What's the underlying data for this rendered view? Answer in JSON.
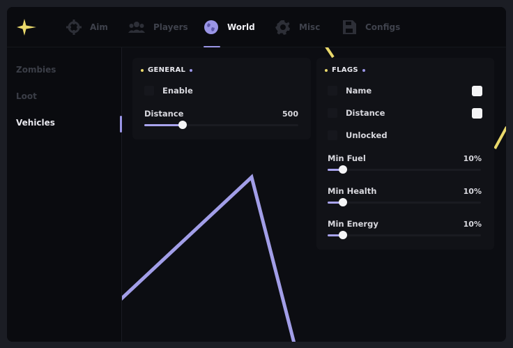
{
  "colors": {
    "accent": "#9a95e6",
    "highlight": "#e9d86b",
    "background": "#0c0d12"
  },
  "tabs": [
    {
      "label": "Aim",
      "icon": "crosshair-icon",
      "active": false
    },
    {
      "label": "Players",
      "icon": "users-icon",
      "active": false
    },
    {
      "label": "World",
      "icon": "globe-icon",
      "active": true
    },
    {
      "label": "Misc",
      "icon": "gear-icon",
      "active": false
    },
    {
      "label": "Configs",
      "icon": "save-icon",
      "active": false
    }
  ],
  "sidebar": {
    "items": [
      {
        "label": "Zombies",
        "active": false
      },
      {
        "label": "Loot",
        "active": false
      },
      {
        "label": "Vehicles",
        "active": true
      }
    ]
  },
  "general": {
    "title": "GENERAL",
    "enable_label": "Enable",
    "enable_checked": false,
    "distance_label": "Distance",
    "distance_value": "500",
    "distance_fraction": 0.25
  },
  "flags": {
    "title": "FLAGS",
    "name_label": "Name",
    "name_checked": false,
    "name_color": "#f4f4f6",
    "distance_label": "Distance",
    "distance_checked": false,
    "distance_color": "#f4f4f6",
    "unlocked_label": "Unlocked",
    "unlocked_checked": false,
    "min_fuel_label": "Min Fuel",
    "min_fuel_value": "10%",
    "min_fuel_fraction": 0.1,
    "min_health_label": "Min Health",
    "min_health_value": "10%",
    "min_health_fraction": 0.1,
    "min_energy_label": "Min Energy",
    "min_energy_value": "10%",
    "min_energy_fraction": 0.1
  }
}
